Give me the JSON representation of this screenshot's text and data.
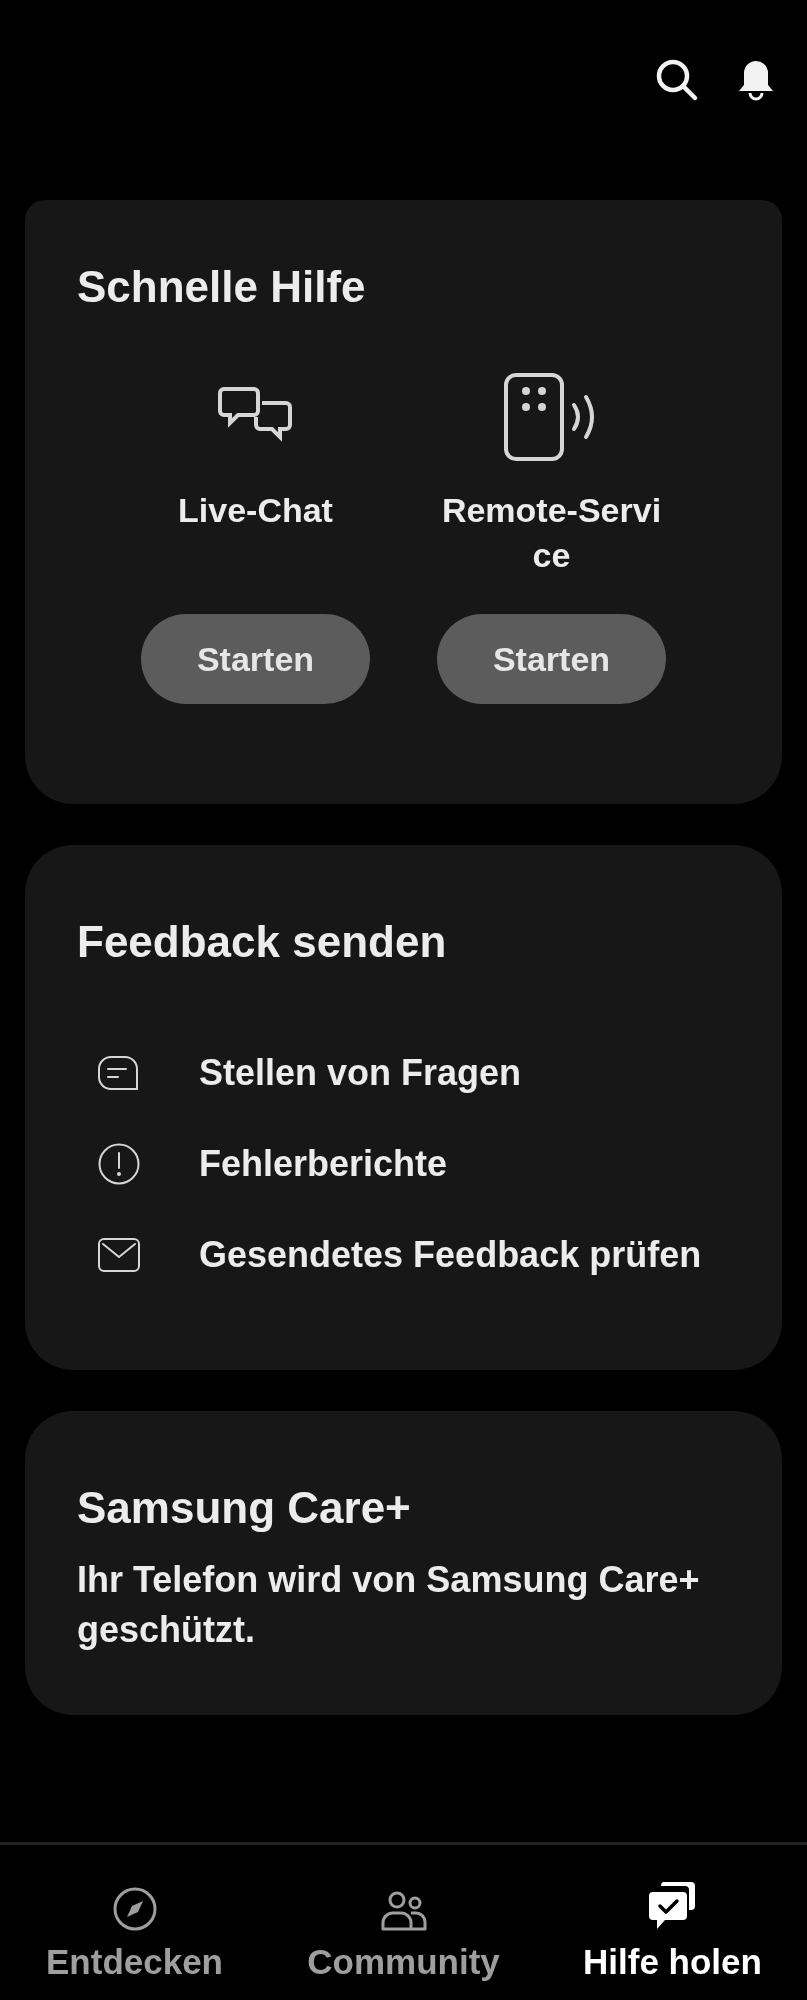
{
  "quick_help": {
    "title": "Schnelle Hilfe",
    "options": [
      {
        "kind": "chat",
        "label": "Live-Chat",
        "button": "Starten"
      },
      {
        "kind": "remote",
        "label": "Remote-Service",
        "button": "Starten"
      }
    ]
  },
  "feedback": {
    "title": "Feedback senden",
    "items": [
      {
        "kind": "question",
        "label": "Stellen von Fragen"
      },
      {
        "kind": "error",
        "label": "Fehlerberichte"
      },
      {
        "kind": "mail",
        "label": "Gesendetes Feedback prüfen"
      }
    ]
  },
  "care": {
    "title": "Samsung Care+",
    "text": "Ihr Telefon wird von Samsung Care+ geschützt."
  },
  "bottom_nav": [
    {
      "kind": "discover",
      "label": "Entdecken",
      "selected": false
    },
    {
      "kind": "community",
      "label": "Community",
      "selected": false
    },
    {
      "kind": "help",
      "label": "Hilfe holen",
      "selected": true
    }
  ]
}
